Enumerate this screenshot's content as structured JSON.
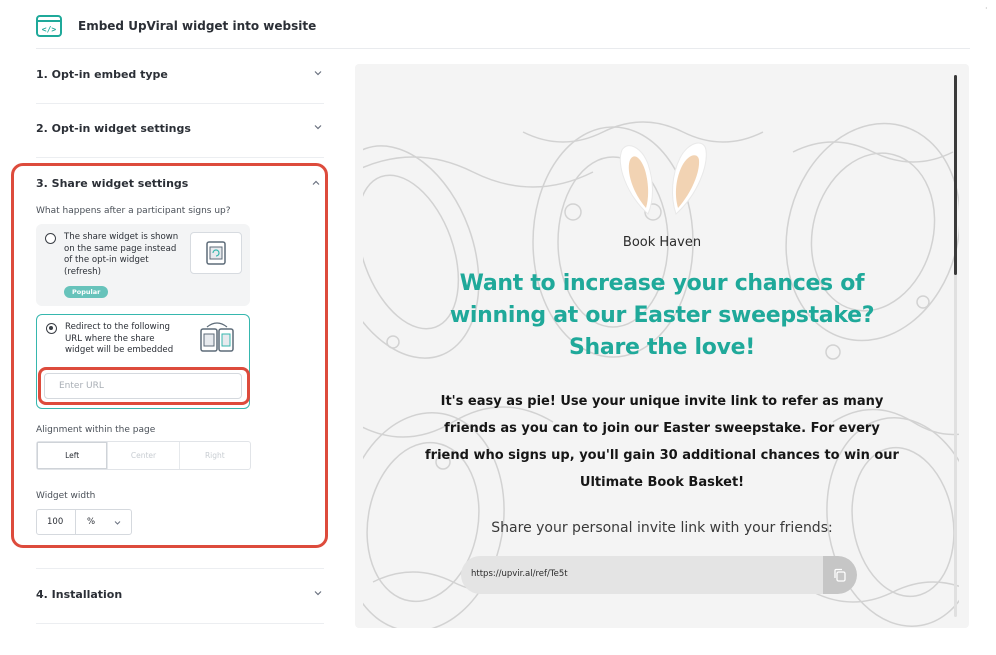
{
  "header": {
    "title": "Embed UpViral widget into website"
  },
  "sections": [
    {
      "label": "1. Opt-in embed type"
    },
    {
      "label": "2. Opt-in widget settings"
    },
    {
      "label": "3. Share widget settings"
    },
    {
      "label": "4. Installation"
    }
  ],
  "share_settings": {
    "question": "What happens after a participant signs up?",
    "option_refresh": {
      "text": "The share widget is shown on the same page instead of the opt-in widget (refresh)",
      "badge": "Popular",
      "selected": false
    },
    "option_redirect": {
      "text": "Redirect to the following URL where the share widget will be embedded",
      "selected": true
    },
    "url_placeholder": "Enter URL",
    "alignment_label": "Alignment within the page",
    "alignment_options": [
      "Left",
      "Center",
      "Right"
    ],
    "alignment_selected": "Left",
    "width_label": "Widget width",
    "width_value": "100",
    "width_unit": "%"
  },
  "preview": {
    "brand": "Book Haven",
    "headline": "Want to increase your chances of winning at our Easter sweepstake? Share the love!",
    "body": "It's easy as pie! Use your unique invite link to refer as many friends as you can to join our Easter sweepstake. For every friend who signs up, you'll gain 30 additional chances to win our Ultimate Book Basket!",
    "share_prompt": "Share your personal invite link with your friends:",
    "invite_link": "https://upvir.al/ref/Te5t"
  },
  "colors": {
    "accent_teal": "#1fa99a",
    "highlight_red": "#dd4b3c"
  },
  "icons": [
    "code-icon",
    "chevron-down-icon",
    "chevron-up-icon",
    "refresh-icon",
    "redirect-icon",
    "copy-icon"
  ]
}
